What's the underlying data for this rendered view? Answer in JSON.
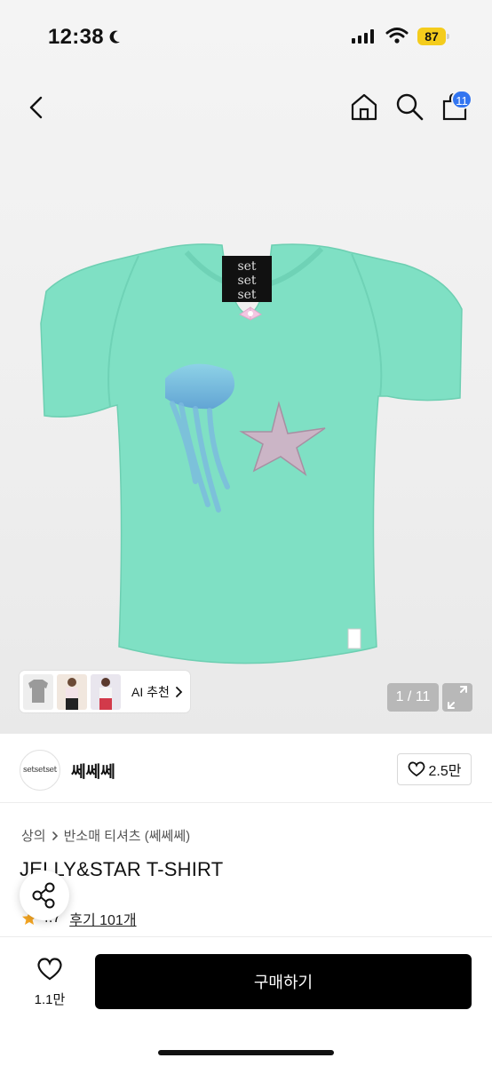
{
  "status_bar": {
    "time": "12:38",
    "battery": "87"
  },
  "nav": {
    "cart_count": "11"
  },
  "gallery": {
    "pager": "1 / 11",
    "ai_label": "AI 추천"
  },
  "brand": {
    "logo_text": "setsetset",
    "name": "쎄쎄쎄",
    "likes": "2.5만"
  },
  "product": {
    "breadcrumb": [
      "상의",
      "반소매 티셔츠 (쎄쎄쎄)"
    ],
    "title": "JELLY&STAR T-SHIRT",
    "rating": "4.7",
    "reviews": "후기 101개"
  },
  "bottom": {
    "wish_count": "1.1만",
    "buy_label": "구매하기"
  },
  "colors": {
    "accent": "#3275f0",
    "battery": "#f4cc1c",
    "shirt": "#7fe0c4",
    "buy": "#000000"
  },
  "icons": [
    "back-icon",
    "home-icon",
    "search-icon",
    "bag-icon",
    "chevron-right-icon",
    "expand-icon",
    "heart-icon",
    "share-icon",
    "star-icon"
  ]
}
